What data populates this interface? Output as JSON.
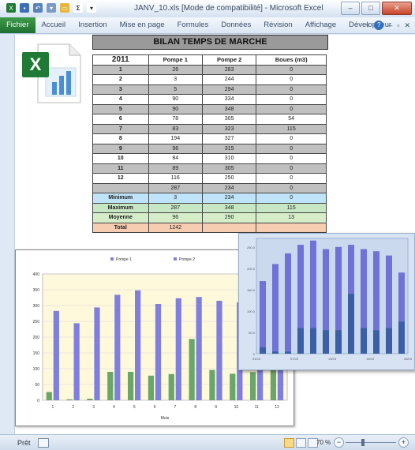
{
  "window": {
    "title": "JANV_10.xls  [Mode de compatibilité] - Microsoft Excel",
    "colors": {
      "file_tab": "#1f7030",
      "frame": "#dfe9f5",
      "series1": "#7f7fe0",
      "series2": "#6aa56a"
    }
  },
  "qat": {
    "icons": [
      "excel-icon",
      "save-icon",
      "undo-icon",
      "redo-icon",
      "folder-icon",
      "sum-icon",
      "sort-icon"
    ]
  },
  "ribbon": {
    "tabs": [
      "Fichier",
      "Accueil",
      "Insertion",
      "Mise en page",
      "Formules",
      "Données",
      "Révision",
      "Affichage",
      "Développeur"
    ]
  },
  "report": {
    "title": "BILAN TEMPS DE MARCHE",
    "headers": [
      "2011",
      "Pompe 1",
      "Pompe 2",
      "Boues (m3)"
    ],
    "rows": [
      [
        "1",
        "26",
        "283",
        "0"
      ],
      [
        "2",
        "3",
        "244",
        "0"
      ],
      [
        "3",
        "5",
        "294",
        "0"
      ],
      [
        "4",
        "90",
        "334",
        "0"
      ],
      [
        "5",
        "90",
        "348",
        "0"
      ],
      [
        "6",
        "78",
        "305",
        "54"
      ],
      [
        "7",
        "83",
        "323",
        "115"
      ],
      [
        "8",
        "194",
        "327",
        "0"
      ],
      [
        "9",
        "96",
        "315",
        "0"
      ],
      [
        "10",
        "84",
        "310",
        "0"
      ],
      [
        "11",
        "89",
        "305",
        "0"
      ],
      [
        "12",
        "116",
        "250",
        "0"
      ],
      [
        "",
        "287",
        "234",
        "0"
      ]
    ],
    "stats": [
      [
        "Minimum",
        "3",
        "234",
        "0"
      ],
      [
        "Maximum",
        "287",
        "348",
        "115"
      ],
      [
        "Moyenne",
        "96",
        "290",
        "13"
      ],
      [
        "Total",
        "1242",
        "",
        ""
      ]
    ]
  },
  "chart_data": [
    {
      "type": "bar",
      "categories": [
        "1",
        "2",
        "3",
        "4",
        "5",
        "6",
        "7",
        "8",
        "9",
        "10",
        "11",
        "12"
      ],
      "series": [
        {
          "name": "Pompe 1",
          "values": [
            26,
            3,
            5,
            90,
            90,
            78,
            83,
            194,
            96,
            84,
            89,
            116
          ]
        },
        {
          "name": "Pompe 2",
          "values": [
            283,
            244,
            294,
            334,
            348,
            305,
            323,
            327,
            315,
            310,
            305,
            250
          ]
        }
      ],
      "xlabel": "Mois",
      "ylim": [
        0,
        400
      ],
      "yticks": [
        "0",
        "50",
        "100",
        "150",
        "200",
        "250",
        "300",
        "350",
        "400"
      ],
      "legend": "top"
    },
    {
      "type": "bar",
      "series": [
        {
          "values": [
            170,
            210,
            235,
            255,
            265,
            245,
            250,
            255,
            245,
            240,
            230,
            190
          ]
        },
        {
          "values": [
            15,
            5,
            5,
            60,
            60,
            55,
            55,
            140,
            60,
            55,
            60,
            75
          ]
        }
      ],
      "yticks": [
        "0",
        "50.0",
        "100.0",
        "150.0",
        "200.0",
        "250.0"
      ],
      "xticklabels": [
        "01/03",
        "07/03",
        "13/03",
        "19/03",
        "25/03"
      ]
    }
  ],
  "statusbar": {
    "ready": "Prêt",
    "zoom": "70 %",
    "minus": "−",
    "plus": "+"
  }
}
